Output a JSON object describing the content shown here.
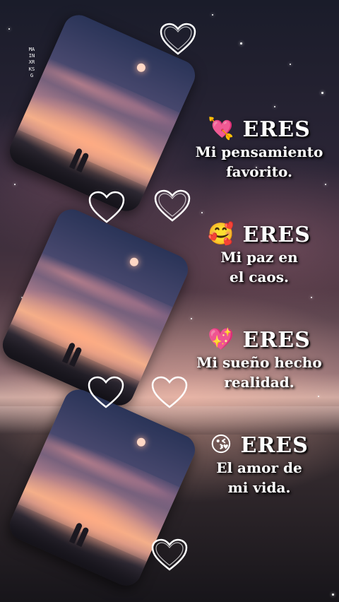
{
  "watermark": "MAINXRKSG",
  "phrases": [
    {
      "emoji": "💘",
      "emoji_icon": "heart-arrow-icon",
      "title": "ERES",
      "line1": "Mi pensamiento",
      "line2": "favorito."
    },
    {
      "emoji": "🥰",
      "emoji_icon": "smiling-face-hearts-icon",
      "title": "ERES",
      "line1": "Mi paz en",
      "line2": "el caos."
    },
    {
      "emoji": "💖",
      "emoji_icon": "sparkling-heart-icon",
      "title": "ERES",
      "line1": "Mi sueño hecho",
      "line2": "realidad."
    },
    {
      "emoji": "😘",
      "emoji_icon": "face-blowing-kiss-icon",
      "title": "ERES",
      "line1": "El amor de",
      "line2": "mi vida."
    }
  ],
  "colors": {
    "text": "#ffffff",
    "heart_outline": "#ffffff",
    "sunset": "#f0b08c"
  }
}
